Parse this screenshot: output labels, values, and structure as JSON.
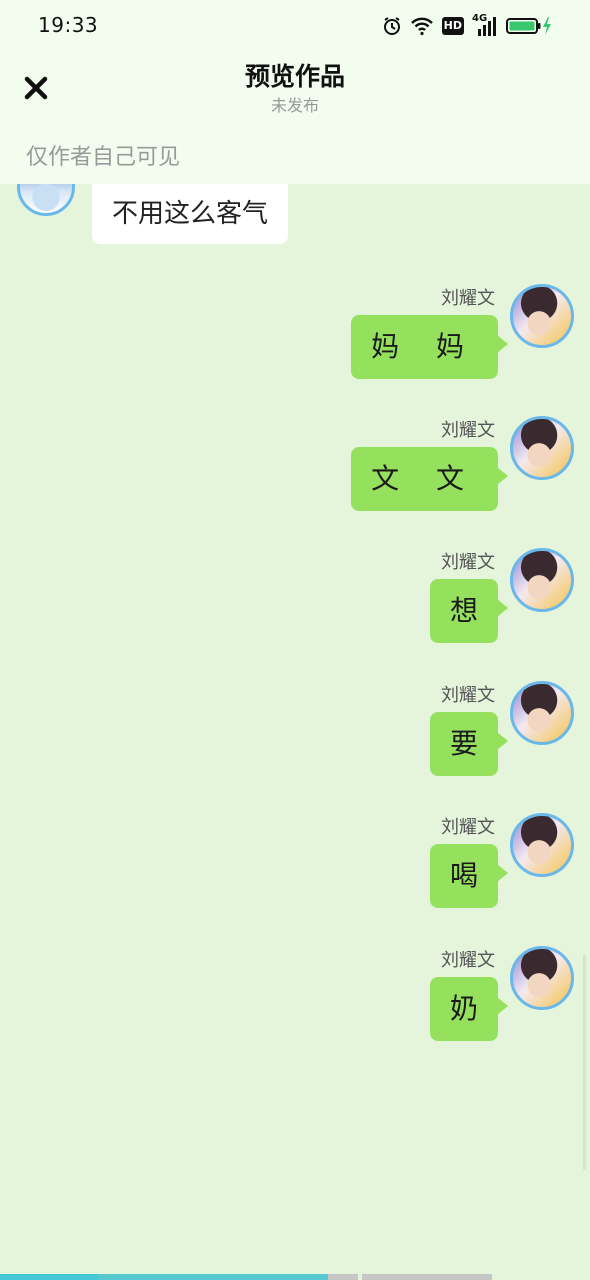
{
  "status_bar": {
    "time": "19:33",
    "icons": [
      "alarm-icon",
      "wifi-icon",
      "hd-icon",
      "signal-4g-icon",
      "battery-charging-icon"
    ],
    "hd_label": "HD",
    "network_label": "4G"
  },
  "header": {
    "close_icon": "close-icon",
    "title": "预览作品",
    "subtitle": "未发布",
    "visibility_note": "仅作者自己可见"
  },
  "chat": {
    "left_message": {
      "text": "不用这么客气",
      "avatar": "avatar"
    },
    "right_messages": [
      {
        "name": "刘耀文",
        "text": "妈 妈"
      },
      {
        "name": "刘耀文",
        "text": "文 文"
      },
      {
        "name": "刘耀文",
        "text": "想"
      },
      {
        "name": "刘耀文",
        "text": "要"
      },
      {
        "name": "刘耀文",
        "text": "喝"
      },
      {
        "name": "刘耀文",
        "text": "奶"
      }
    ]
  },
  "colors": {
    "chat_background": "#e4f5dc",
    "header_background": "#f2fcef",
    "right_bubble": "#95e15e",
    "left_bubble": "#ffffff",
    "avatar_ring": "#6ab8ea",
    "progress_active": "#42c8d6"
  }
}
